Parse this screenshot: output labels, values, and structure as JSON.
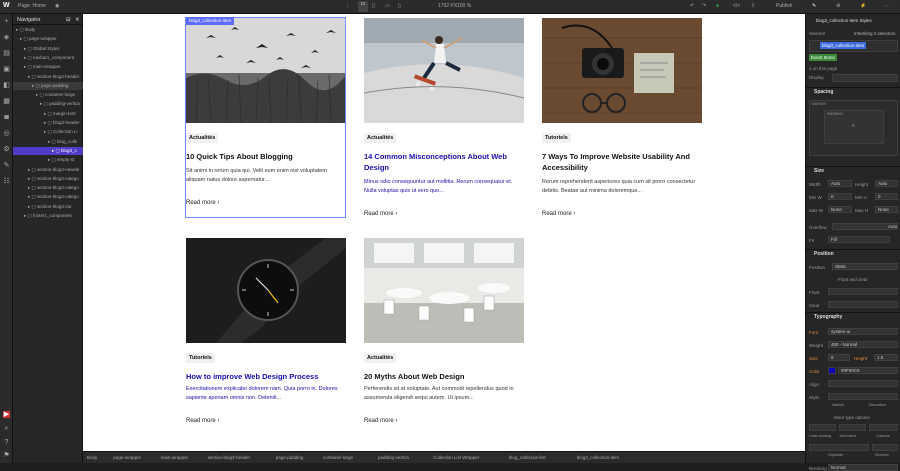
{
  "topbar": {
    "page_label": "Page: Home",
    "viewport_size": "1792 PX",
    "zoom": "100 %",
    "publish": "Publish"
  },
  "navigator": {
    "title": "Navigator",
    "items": [
      {
        "label": "Body",
        "indent": 0
      },
      {
        "label": "page-wrapper",
        "indent": 1
      },
      {
        "label": "Global Styles",
        "indent": 2
      },
      {
        "label": "navbar1_component",
        "indent": 2
      },
      {
        "label": "main-wrapper",
        "indent": 2
      },
      {
        "label": "section-blog3-header",
        "indent": 3
      },
      {
        "label": "page-padding",
        "indent": 4
      },
      {
        "label": "container-large",
        "indent": 5
      },
      {
        "label": "padding-vertica",
        "indent": 6
      },
      {
        "label": "margin-bott",
        "indent": 7
      },
      {
        "label": "blog3-header",
        "indent": 7
      },
      {
        "label": "Collection Li",
        "indent": 7
      },
      {
        "label": "blog_colle",
        "indent": 8
      },
      {
        "label": "blog3_c",
        "indent": 9
      },
      {
        "label": "empty-st",
        "indent": 8
      },
      {
        "label": "section-blog3-newsle",
        "indent": 3
      },
      {
        "label": "section-blog3-catego",
        "indent": 3
      },
      {
        "label": "section-blog3-catego",
        "indent": 3
      },
      {
        "label": "section-blog3-catego",
        "indent": 3
      },
      {
        "label": "section-blog3-cta",
        "indent": 3
      },
      {
        "label": "footer1_component",
        "indent": 2
      }
    ]
  },
  "canvas": {
    "selected_label": "blog3_collection-item",
    "read_more": "Read more",
    "cards": [
      {
        "tag": "Actualités",
        "title": "10 Quick Tips About Blogging",
        "excerpt": "Sit animi in rerum quia qui. Velit eum enim nisi voluptatem aliquam natus dolore aspernatur...",
        "title_color": "#111111",
        "image": "birds"
      },
      {
        "tag": "Actualités",
        "title": "14 Common Misconceptions About Web Design",
        "excerpt": "Minus odio consequuntur aut mollitia. Rerum consequatur et. Nulla voluptas quis ut vero quo...",
        "title_color": "#1a0dab",
        "image": "skateboard"
      },
      {
        "tag": "Tutoriels",
        "title": "7 Ways To Improve Website Usability And Accessibility",
        "excerpt": "Rerum reprehenderit asperiores quia cum sit porro consectetur debitis. Beatae aut minima doloremque...",
        "title_color": "#111111",
        "image": "camera"
      },
      {
        "tag": "Tutoriels",
        "title": "How to improve Web Design Process",
        "excerpt": "Exercitationem explicabo dolorem nam. Quia porro in. Dolores sapiente aperiam omnis non. Deleniti...",
        "title_color": "#1a0dab",
        "image": "watch"
      },
      {
        "tag": "Actualités",
        "title": "20 Myths About Web Design",
        "excerpt": "Perferendis sit at voluptate. Aut commodi repellendus quod in assumenda eligendi sequi autem. Ut ipsum...",
        "title_color": "#111111",
        "image": "cafe"
      }
    ]
  },
  "breadcrumb": [
    "Body",
    "page-wrapper",
    "main-wrapper",
    "section-blog3-header",
    "page-padding",
    "container-large",
    "padding-vertica",
    "Collection List Wrapper",
    "blog_collection-list",
    "blog3_collection-item"
  ],
  "style_panel": {
    "element_title": "blog3_collection-item Styles",
    "selector_label": "Selector",
    "inheriting": "Inheriting 2 selectors",
    "selector_class": "blog3_collection-item",
    "event_badge": "Event Items",
    "on_page": "1 on this page",
    "display_label": "Display",
    "sections": {
      "spacing": "Spacing",
      "size": "Size",
      "position": "Position",
      "typography": "Typography"
    },
    "margin_label": "MARGIN",
    "padding_label": "PADDING",
    "zero": "0",
    "size": {
      "width": "Width",
      "width_val": "Auto",
      "height": "Height",
      "height_val": "Auto",
      "min_w": "Min W",
      "min_w_val": "0",
      "min_h": "Min H",
      "min_h_val": "0",
      "max_w": "Max W",
      "max_w_val": "None",
      "max_h": "Max H",
      "max_h_val": "None",
      "overflow": "Overflow",
      "overflow_val": "Auto",
      "fit": "Fit",
      "fit_val": "Fill"
    },
    "position": {
      "position_label": "Position",
      "position_val": "Static",
      "float_label": "Float and clear",
      "float": "Float",
      "clear": "Clear"
    },
    "typography": {
      "font": "Font",
      "font_val": "system-ui",
      "weight": "Weight",
      "weight_val": "400 - Normal",
      "size": "Size",
      "size_val": "9",
      "height_label": "Height",
      "height_val": "1.5",
      "color": "Color",
      "color_val": "#0F00C0",
      "align": "Align",
      "style": "Style",
      "italicize": "Italicize",
      "decoration": "Decoration",
      "more_type": "More type options",
      "letter_spacing": "Letter spacing",
      "text_indent": "Text indent",
      "columns": "Columns",
      "capitalize": "Capitalize",
      "direction": "Direction",
      "breaking": "Breaking",
      "breaking_val": "Normal"
    },
    "colors": {
      "accent": "#4f3cc9",
      "link_color": "#0F00C0"
    }
  }
}
